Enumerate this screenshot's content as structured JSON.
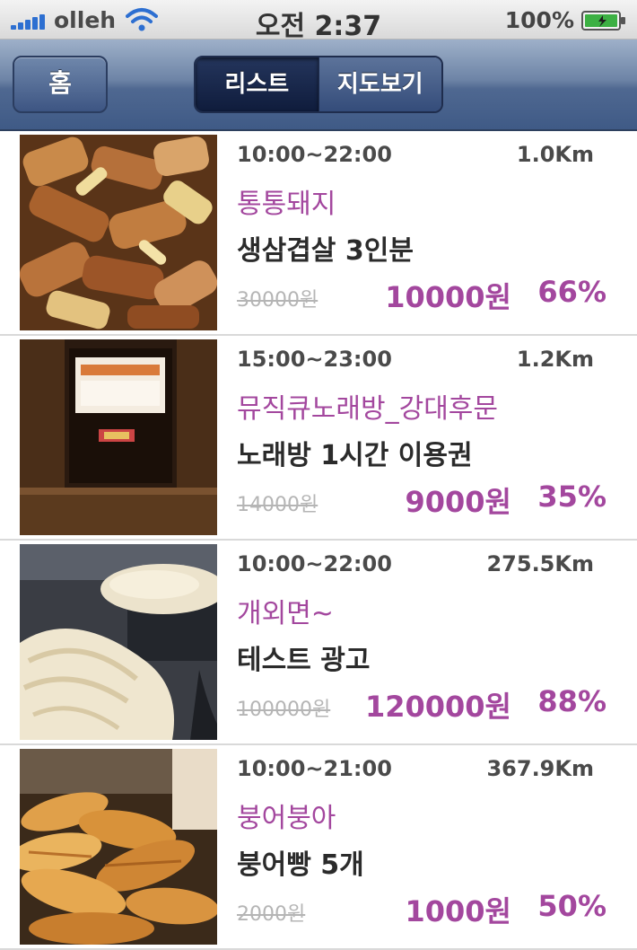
{
  "status_bar": {
    "carrier": "olleh",
    "time": "오전 2:37",
    "battery": "100%"
  },
  "nav": {
    "home_label": "홈",
    "segments": [
      {
        "label": "리스트",
        "selected": true
      },
      {
        "label": "지도보기",
        "selected": false
      }
    ]
  },
  "deals": [
    {
      "hours": "10:00~22:00",
      "distance": "1.0Km",
      "shop": "통통돼지",
      "product": "생삼겹살 3인분",
      "original_price": "30000원",
      "sale_price": "10000원",
      "discount": "66%",
      "image": "grilled-pork-belly-photo"
    },
    {
      "hours": "15:00~23:00",
      "distance": "1.2Km",
      "shop": "뮤직큐노래방_강대후문",
      "product": "노래방 1시간 이용권",
      "original_price": "14000원",
      "sale_price": "9000원",
      "discount": "35%",
      "image": "karaoke-room-photo"
    },
    {
      "hours": "10:00~22:00",
      "distance": "275.5Km",
      "shop": "개외면~",
      "product": "테스트 광고",
      "original_price": "100000원",
      "sale_price": "120000원",
      "discount": "88%",
      "image": "grilled-fish-photo"
    },
    {
      "hours": "10:00~21:00",
      "distance": "367.9Km",
      "shop": "붕어붕아",
      "product": "붕어빵 5개",
      "original_price": "2000원",
      "sale_price": "1000원",
      "discount": "50%",
      "image": "fish-shaped-bread-photo"
    }
  ]
}
